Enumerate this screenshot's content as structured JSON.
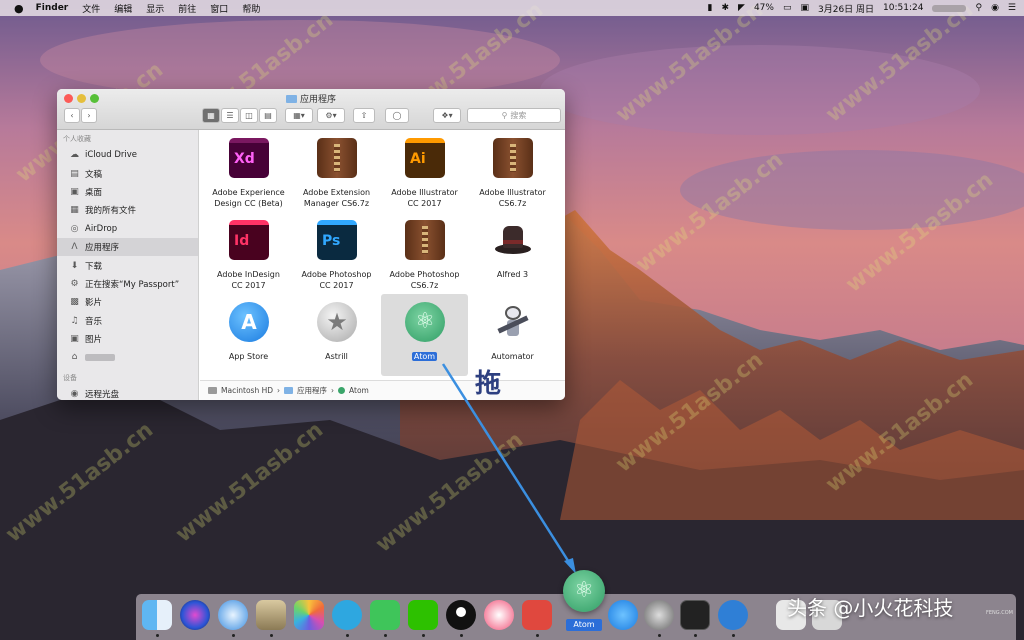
{
  "menubar": {
    "apple": "",
    "app": "Finder",
    "menus": [
      "文件",
      "编辑",
      "显示",
      "前往",
      "窗口",
      "帮助"
    ],
    "battery": "47%",
    "date": "3月26日 周日",
    "time": "10:51:24"
  },
  "window": {
    "title": "应用程序",
    "search_placeholder": "搜索"
  },
  "sidebar": {
    "favorites_header": "个人收藏",
    "items": [
      {
        "label": "iCloud Drive",
        "icon": "cloud-icon"
      },
      {
        "label": "文稿",
        "icon": "documents-icon"
      },
      {
        "label": "桌面",
        "icon": "desktop-icon"
      },
      {
        "label": "我的所有文件",
        "icon": "all-files-icon"
      },
      {
        "label": "AirDrop",
        "icon": "airdrop-icon"
      },
      {
        "label": "应用程序",
        "icon": "applications-icon",
        "selected": true
      },
      {
        "label": "下载",
        "icon": "downloads-icon"
      },
      {
        "label": "正在搜索“My Passport”",
        "icon": "gear-icon"
      },
      {
        "label": "影片",
        "icon": "movies-icon"
      },
      {
        "label": "音乐",
        "icon": "music-icon"
      },
      {
        "label": "图片",
        "icon": "pictures-icon"
      }
    ],
    "devices_header": "设备",
    "remote_disc": "远程光盘"
  },
  "files": [
    {
      "name1": "Adobe Experience",
      "name2": "Design CC (Beta)",
      "icon": "xd-icon",
      "color": "#470137"
    },
    {
      "name1": "Adobe Extension",
      "name2": "Manager CS6.7z",
      "icon": "archive-icon",
      "color": "#6b3a1e"
    },
    {
      "name1": "Adobe Illustrator",
      "name2": "CC 2017",
      "icon": "ai-icon",
      "color": "#4a2a08"
    },
    {
      "name1": "Adobe Illustrator",
      "name2": "CS6.7z",
      "icon": "archive-icon",
      "color": "#6b3a1e"
    },
    {
      "name1": "Adobe InDesign",
      "name2": "CC 2017",
      "icon": "id-icon",
      "color": "#49021f"
    },
    {
      "name1": "Adobe Photoshop",
      "name2": "CC 2017",
      "icon": "ps-icon",
      "color": "#0a2a40"
    },
    {
      "name1": "Adobe Photoshop",
      "name2": "CS6.7z",
      "icon": "archive-icon",
      "color": "#6b3a1e"
    },
    {
      "name1": "Alfred 3",
      "name2": "",
      "icon": "alfred-hat-icon",
      "color": "#3a2a2a"
    },
    {
      "name1": "App Store",
      "name2": "",
      "icon": "app-store-icon",
      "color": "#1a7be0"
    },
    {
      "name1": "Astrill",
      "name2": "",
      "icon": "star-icon",
      "color": "#c8c8c8"
    },
    {
      "name1": "Atom",
      "name2": "",
      "icon": "atom-icon",
      "color": "#3aa56a",
      "selected": true
    },
    {
      "name1": "Automator",
      "name2": "",
      "icon": "robot-icon",
      "color": "#6b6b7a"
    }
  ],
  "pathbar": {
    "disk": "Macintosh HD",
    "folder": "应用程序",
    "item": "Atom"
  },
  "annotation": {
    "drag_label": "拖"
  },
  "dock": {
    "atom_label": "Atom",
    "brand": "头条 @小火花科技",
    "tiny": "FENG.COM"
  },
  "watermark": "www.51asb.cn"
}
